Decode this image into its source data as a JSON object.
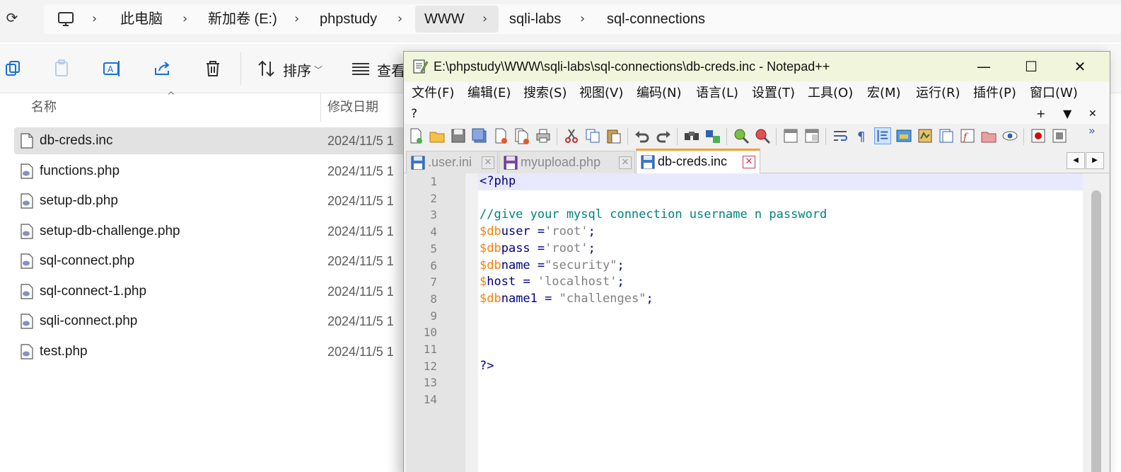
{
  "explorer": {
    "breadcrumbs": [
      "此电脑",
      "新加卷 (E:)",
      "phpstudy",
      "WWW",
      "sqli-labs",
      "sql-connections"
    ],
    "toolbar": {
      "sort_label": "排序",
      "view_label": "查看"
    },
    "columns": {
      "name": "名称",
      "modified": "修改日期"
    },
    "files": [
      {
        "name": "db-creds.inc",
        "date": "2024/11/5 1",
        "icon": "file-icon"
      },
      {
        "name": "functions.php",
        "date": "2024/11/5 1",
        "icon": "php-file-icon"
      },
      {
        "name": "setup-db.php",
        "date": "2024/11/5 1",
        "icon": "php-file-icon"
      },
      {
        "name": "setup-db-challenge.php",
        "date": "2024/11/5 1",
        "icon": "php-file-icon"
      },
      {
        "name": "sql-connect.php",
        "date": "2024/11/5 1",
        "icon": "php-file-icon"
      },
      {
        "name": "sql-connect-1.php",
        "date": "2024/11/5 1",
        "icon": "php-file-icon"
      },
      {
        "name": "sqli-connect.php",
        "date": "2024/11/5 1",
        "icon": "php-file-icon"
      },
      {
        "name": "test.php",
        "date": "2024/11/5 1",
        "icon": "php-file-icon"
      }
    ]
  },
  "notepad": {
    "title": "E:\\phpstudy\\WWW\\sqli-labs\\sql-connections\\db-creds.inc - Notepad++",
    "menu": [
      "文件(F)",
      "编辑(E)",
      "搜索(S)",
      "视图(V)",
      "编码(N)",
      "语言(L)",
      "设置(T)",
      "工具(O)",
      "宏(M)",
      "运行(R)",
      "插件(P)",
      "窗口(W)"
    ],
    "menu_help": "?",
    "menu_right": {
      "add": "+",
      "dropdown": "▼",
      "close": "✕"
    },
    "tabs": [
      {
        "label": ".user.ini",
        "active": false
      },
      {
        "label": "myupload.php",
        "active": false
      },
      {
        "label": "db-creds.inc",
        "active": true
      }
    ],
    "line_numbers": [
      "1",
      "2",
      "3",
      "4",
      "5",
      "6",
      "7",
      "8",
      "9",
      "10",
      "11",
      "12",
      "13",
      "14"
    ],
    "code": [
      [
        {
          "t": "<?",
          "c": "tag"
        },
        {
          "t": "php",
          "c": "id"
        }
      ],
      [],
      [
        {
          "t": "//give your mysql connection username n password",
          "c": "comment"
        }
      ],
      [
        {
          "t": "$db",
          "c": "var"
        },
        {
          "t": "user",
          "c": "id"
        },
        {
          "t": " =",
          "c": "op"
        },
        {
          "t": "'root'",
          "c": "sq"
        },
        {
          "t": ";",
          "c": "op"
        }
      ],
      [
        {
          "t": "$db",
          "c": "var"
        },
        {
          "t": "pass",
          "c": "id"
        },
        {
          "t": " =",
          "c": "op"
        },
        {
          "t": "'root'",
          "c": "sq"
        },
        {
          "t": ";",
          "c": "op"
        }
      ],
      [
        {
          "t": "$db",
          "c": "var"
        },
        {
          "t": "name",
          "c": "id"
        },
        {
          "t": " =",
          "c": "op"
        },
        {
          "t": "\"security\"",
          "c": "dq"
        },
        {
          "t": ";",
          "c": "op"
        }
      ],
      [
        {
          "t": "$",
          "c": "var"
        },
        {
          "t": "host",
          "c": "id"
        },
        {
          "t": " = ",
          "c": "op"
        },
        {
          "t": "'localhost'",
          "c": "sq"
        },
        {
          "t": ";",
          "c": "op"
        }
      ],
      [
        {
          "t": "$db",
          "c": "var"
        },
        {
          "t": "name1",
          "c": "id"
        },
        {
          "t": " = ",
          "c": "op"
        },
        {
          "t": "\"challenges\"",
          "c": "dq"
        },
        {
          "t": ";",
          "c": "op"
        }
      ],
      [],
      [],
      [],
      [
        {
          "t": "?>",
          "c": "tag"
        }
      ],
      [],
      []
    ]
  },
  "colors": {
    "titlebar_bg": "#f0f5dc",
    "active_tab_accent": "#f0a030",
    "current_line": "#e8e8ff",
    "comment": "#008080",
    "variable": "#ff8000",
    "keyword": "#000080"
  }
}
